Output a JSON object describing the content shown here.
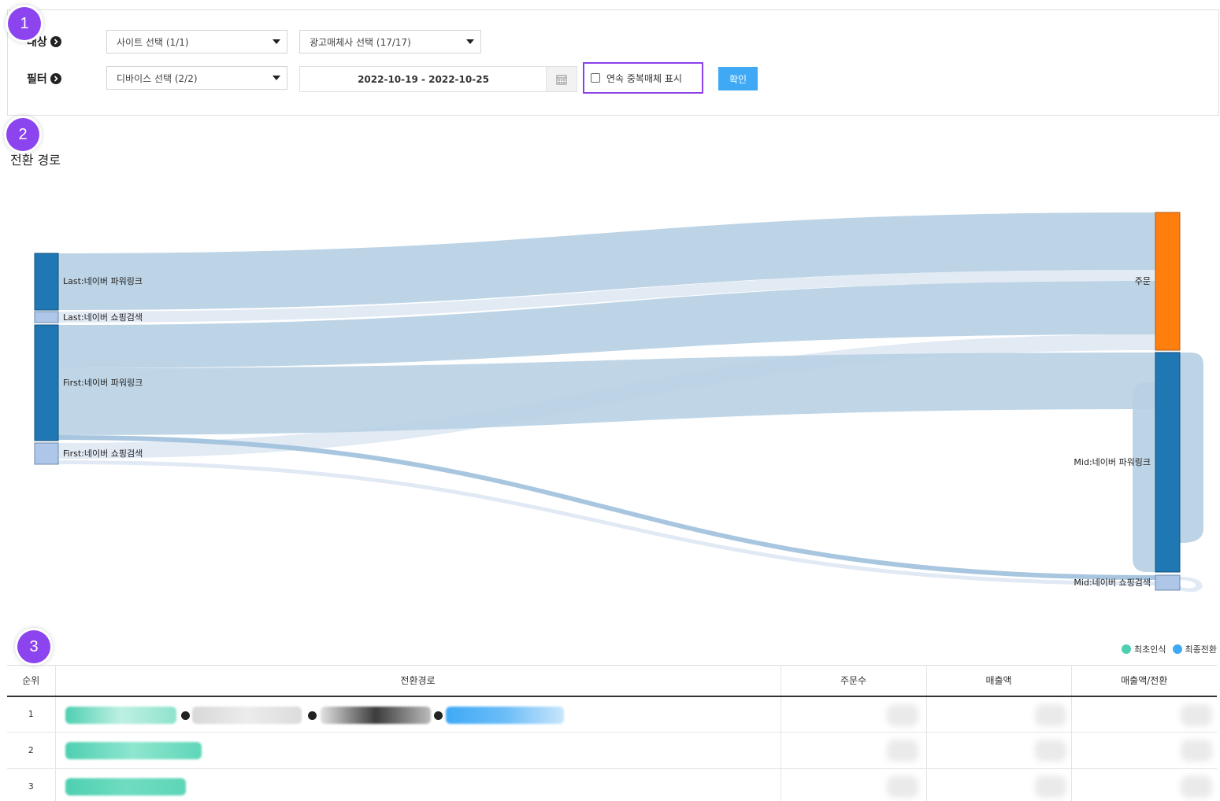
{
  "filters": {
    "target_label": "대상",
    "target_select": "사이트 선택 (1/1)",
    "media_select": "광고매체사 선택 (17/17)",
    "filter_label": "필터",
    "device_select": "디바이스 선택 (2/2)",
    "date_range": "2022-10-19 - 2022-10-25",
    "dup_checkbox_label": "연속 중복매체 표시",
    "dup_checked": false,
    "confirm_button": "확인"
  },
  "badges": [
    "1",
    "2",
    "3"
  ],
  "section_title": "전환 경로",
  "chart_data": {
    "type": "sankey",
    "nodes": [
      {
        "id": "last_pl",
        "label": "Last:네이버 파워링크",
        "color": "#1f77b4"
      },
      {
        "id": "last_sc",
        "label": "Last:네이버 쇼핑검색",
        "color": "#aec7e8"
      },
      {
        "id": "first_pl",
        "label": "First:네이버 파워링크",
        "color": "#1f77b4"
      },
      {
        "id": "first_sc",
        "label": "First:네이버 쇼핑검색",
        "color": "#aec7e8"
      },
      {
        "id": "order",
        "label": "주문",
        "color": "#ff7f0e"
      },
      {
        "id": "mid_pl",
        "label": "Mid:네이버 파워링크",
        "color": "#1f77b4"
      },
      {
        "id": "mid_sc",
        "label": "Mid:네이버 쇼핑검색",
        "color": "#aec7e8"
      }
    ],
    "links": [
      {
        "source": "last_pl",
        "target": "order",
        "value": 72
      },
      {
        "source": "last_sc",
        "target": "order",
        "value": 14
      },
      {
        "source": "first_pl",
        "target": "order",
        "value": 55
      },
      {
        "source": "first_sc",
        "target": "order",
        "value": 20
      },
      {
        "source": "first_pl",
        "target": "mid_pl",
        "value": 75
      },
      {
        "source": "first_pl",
        "target": "mid_sc",
        "value": 6
      },
      {
        "source": "first_sc",
        "target": "mid_sc",
        "value": 5
      },
      {
        "source": "mid_pl",
        "target": "mid_pl",
        "value": 200
      },
      {
        "source": "mid_sc",
        "target": "mid_sc",
        "value": 10
      }
    ]
  },
  "legend": {
    "first_label": "최초인식",
    "first_color": "#4ecfb0",
    "last_label": "최종전환",
    "last_color": "#3fa9f5"
  },
  "table": {
    "headers": [
      "순위",
      "전환경로",
      "주문수",
      "매출액",
      "매출액/전환"
    ],
    "rows": [
      {
        "rank": "1"
      },
      {
        "rank": "2"
      },
      {
        "rank": "3"
      }
    ]
  }
}
